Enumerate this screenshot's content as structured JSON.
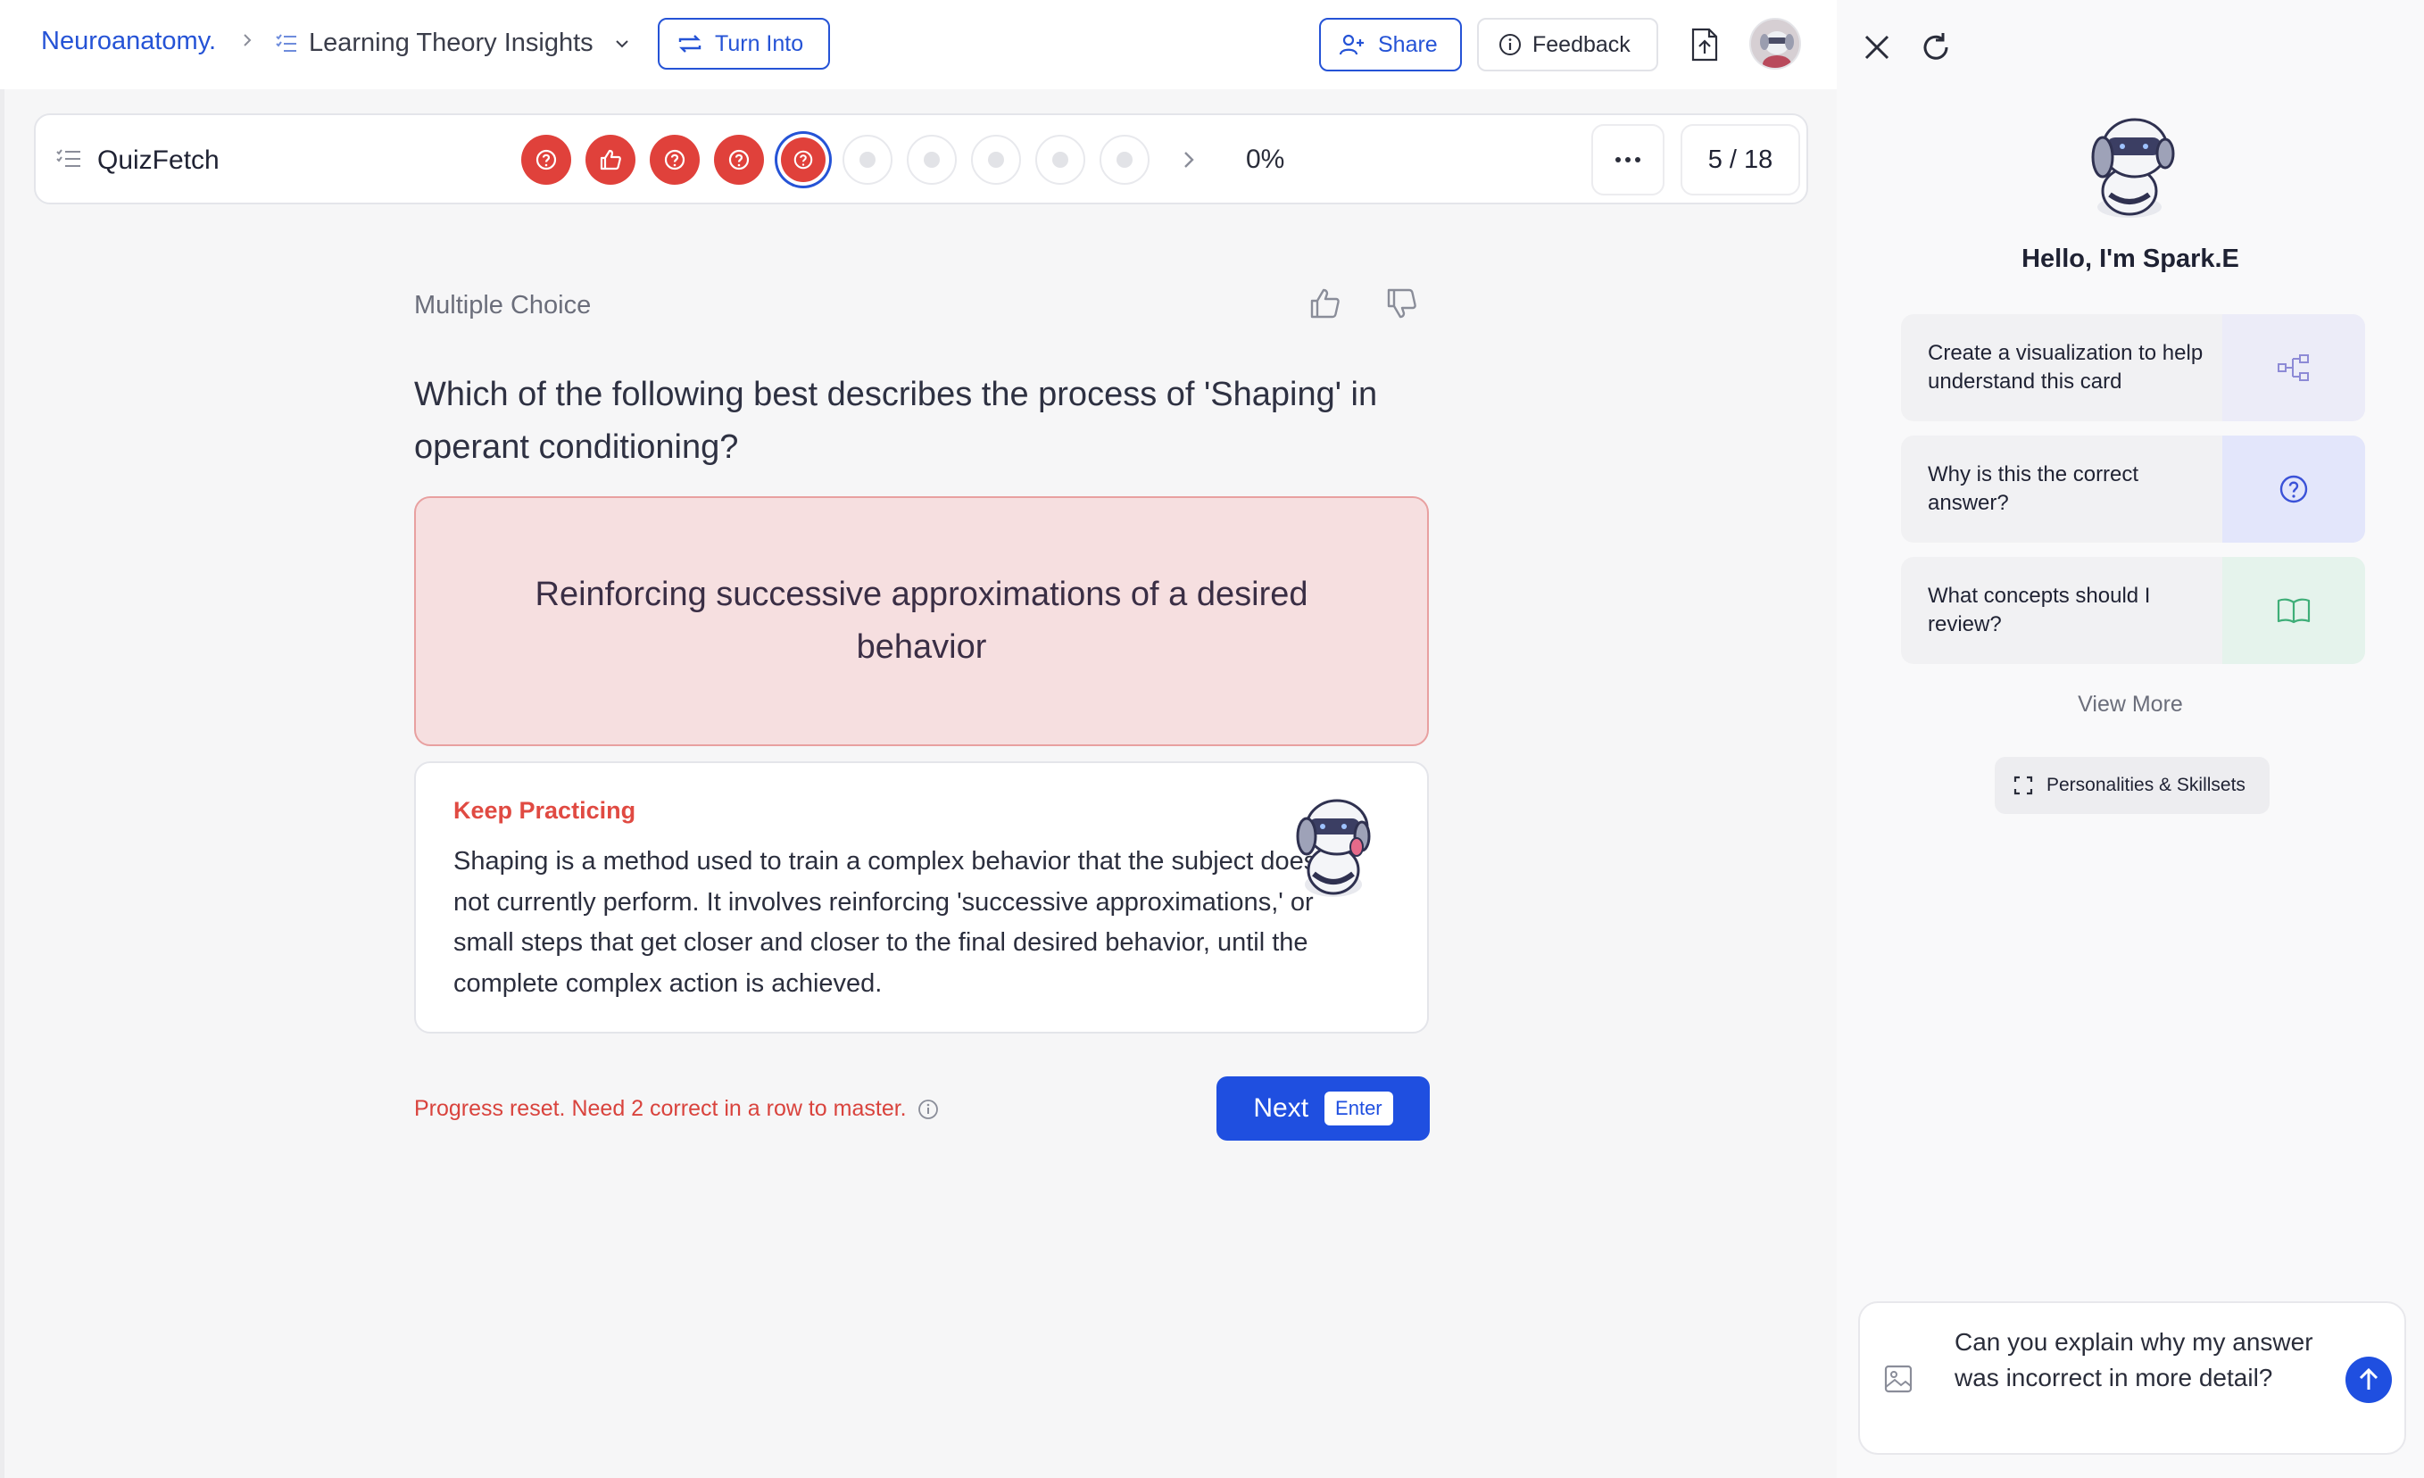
{
  "breadcrumb": {
    "root": "Neuroanatomy.",
    "current": "Learning Theory Insights"
  },
  "toolbar": {
    "turn_into_label": "Turn Into",
    "share_label": "Share",
    "feedback_label": "Feedback"
  },
  "quizbar": {
    "title": "QuizFetch",
    "progress_percent": "0%",
    "counter": "5 / 18",
    "dots": [
      {
        "status": "wrong",
        "icon": "question-icon"
      },
      {
        "status": "wrong",
        "icon": "thumbs-up-icon"
      },
      {
        "status": "wrong",
        "icon": "question-icon"
      },
      {
        "status": "wrong",
        "icon": "question-icon"
      },
      {
        "status": "current",
        "icon": "question-icon"
      },
      {
        "status": "unanswered"
      },
      {
        "status": "unanswered"
      },
      {
        "status": "unanswered"
      },
      {
        "status": "unanswered"
      },
      {
        "status": "unanswered"
      }
    ]
  },
  "question": {
    "type": "Multiple Choice",
    "text": "Which of the following best describes the process of 'Shaping' in operant conditioning?",
    "selected_answer": "Reinforcing successive approximations of a desired behavior"
  },
  "feedback": {
    "title": "Keep Practicing",
    "body": "Shaping is a method used to train a complex behavior that the subject does not currently perform. It involves reinforcing 'successive approximations,' or small steps that get closer and closer to the final desired behavior, until the complete complex action is achieved."
  },
  "progress_message": "Progress reset. Need 2 correct in a row to master.",
  "next_button": {
    "label": "Next",
    "shortcut": "Enter"
  },
  "assistant": {
    "greeting": "Hello, I'm Spark.E",
    "suggestions": [
      {
        "label": "Create a visualization to help understand this card",
        "icon": "diagram-icon",
        "color": "#ececf8"
      },
      {
        "label": "Why is this the correct answer?",
        "icon": "question-icon",
        "color": "#e3e6fb"
      },
      {
        "label": "What concepts should I review?",
        "icon": "book-icon",
        "color": "#e5f3ec"
      }
    ],
    "view_more": "View More",
    "personalities": "Personalities & Skillsets",
    "input_value": "Can you explain why my answer was incorrect in more detail?"
  },
  "colors": {
    "accent": "#1f4fe0",
    "wrong": "#e0413b",
    "link": "#2553d6"
  }
}
